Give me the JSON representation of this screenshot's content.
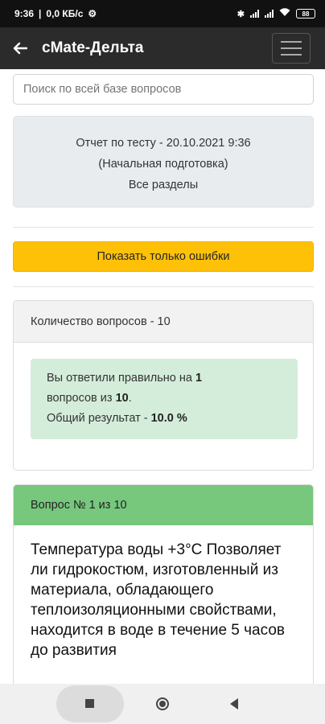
{
  "status_bar": {
    "time": "9:36",
    "speed": "0,0 КБ/с",
    "battery": "88"
  },
  "app_bar": {
    "title": "cMate-Дельта"
  },
  "search": {
    "placeholder": "Поиск по всей базе вопросов"
  },
  "report": {
    "line1": "Отчет по тесту - 20.10.2021 9:36",
    "line2": "(Начальная подготовка)",
    "line3": "Все разделы"
  },
  "filter_button": {
    "label": "Показать только ошибки"
  },
  "summary": {
    "header": "Количество вопросов - 10",
    "answered_prefix": "Вы ответили правильно на",
    "correct_count": "1",
    "questions_of": "вопросов из",
    "total_count": "10",
    "result_prefix": "Общий результат -",
    "result_value": "10.0 %"
  },
  "question": {
    "header": "Вопрос № 1 из 10",
    "text": "Температура воды +3°С Позволяет ли гидрокостюм, изготовленный из материала, обладающего теплоизоляционными свойствами, находится в воде в течение 5 часов до развития"
  },
  "colors": {
    "app_bar": "#2b2b2b",
    "warning_button": "#ffc107",
    "success_alert": "#d4edda",
    "question_header": "#77c77d"
  }
}
